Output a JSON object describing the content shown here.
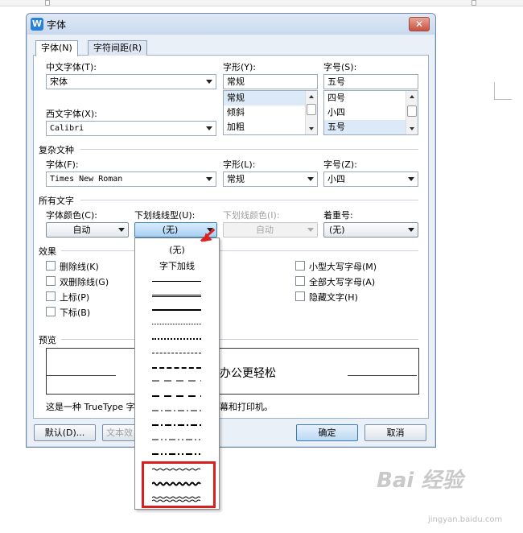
{
  "dialog": {
    "title": "字体",
    "close": "✕",
    "app_icon": "W",
    "tabs": [
      "字体(N)",
      "字符间距(R)"
    ]
  },
  "chinese_font": {
    "label": "中文字体(T):",
    "value": "宋体"
  },
  "western_font": {
    "label": "西文字体(X):",
    "value": "Calibri"
  },
  "style": {
    "label": "字形(Y):",
    "value": "常规",
    "options": [
      "常规",
      "倾斜",
      "加粗"
    ]
  },
  "size": {
    "label": "字号(S):",
    "value": "五号",
    "options": [
      "四号",
      "小四",
      "五号"
    ]
  },
  "complex": {
    "section": "复杂文种",
    "font_label": "字体(F):",
    "font_value": "Times New Roman",
    "style_label": "字形(L):",
    "style_value": "常规",
    "size_label": "字号(Z):",
    "size_value": "小四"
  },
  "all_text": {
    "section": "所有文字",
    "color_label": "字体颜色(C):",
    "color_value": "自动",
    "underline_label": "下划线线型(U):",
    "underline_value": "(无)",
    "underline_color_label": "下划线颜色(I):",
    "underline_color_value": "自动",
    "emphasis_label": "着重号:",
    "emphasis_value": "(无)"
  },
  "effects": {
    "section": "效果",
    "left": [
      "删除线(K)",
      "双删除线(G)",
      "上标(P)",
      "下标(B)"
    ],
    "right": [
      "小型大写字母(M)",
      "全部大写字母(A)",
      "隐藏文字(H)"
    ]
  },
  "preview": {
    "section": "预览",
    "sample_text": "办公更轻松",
    "note_start": "这是一种 TrueType 字",
    "note_end": "幕和打印机。"
  },
  "buttons": {
    "default": "默认(D)...",
    "text_effects": "文本效",
    "ok": "确定",
    "cancel": "取消"
  },
  "underline_popup": {
    "none": "(无)",
    "words_only": "字下加线"
  },
  "watermark": {
    "logo": "Bai 经验",
    "url": "jingyan.baidu.com"
  },
  "colors": {
    "highlight": "#d92020",
    "selected": "#dce9f7"
  }
}
